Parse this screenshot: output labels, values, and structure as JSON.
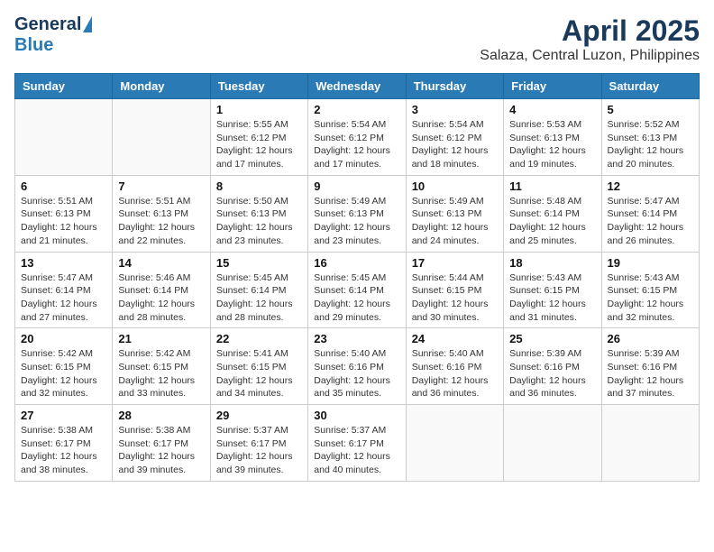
{
  "logo": {
    "general": "General",
    "blue": "Blue"
  },
  "title": "April 2025",
  "subtitle": "Salaza, Central Luzon, Philippines",
  "headers": [
    "Sunday",
    "Monday",
    "Tuesday",
    "Wednesday",
    "Thursday",
    "Friday",
    "Saturday"
  ],
  "weeks": [
    [
      {
        "day": "",
        "info": ""
      },
      {
        "day": "",
        "info": ""
      },
      {
        "day": "1",
        "info": "Sunrise: 5:55 AM\nSunset: 6:12 PM\nDaylight: 12 hours and 17 minutes."
      },
      {
        "day": "2",
        "info": "Sunrise: 5:54 AM\nSunset: 6:12 PM\nDaylight: 12 hours and 17 minutes."
      },
      {
        "day": "3",
        "info": "Sunrise: 5:54 AM\nSunset: 6:12 PM\nDaylight: 12 hours and 18 minutes."
      },
      {
        "day": "4",
        "info": "Sunrise: 5:53 AM\nSunset: 6:13 PM\nDaylight: 12 hours and 19 minutes."
      },
      {
        "day": "5",
        "info": "Sunrise: 5:52 AM\nSunset: 6:13 PM\nDaylight: 12 hours and 20 minutes."
      }
    ],
    [
      {
        "day": "6",
        "info": "Sunrise: 5:51 AM\nSunset: 6:13 PM\nDaylight: 12 hours and 21 minutes."
      },
      {
        "day": "7",
        "info": "Sunrise: 5:51 AM\nSunset: 6:13 PM\nDaylight: 12 hours and 22 minutes."
      },
      {
        "day": "8",
        "info": "Sunrise: 5:50 AM\nSunset: 6:13 PM\nDaylight: 12 hours and 23 minutes."
      },
      {
        "day": "9",
        "info": "Sunrise: 5:49 AM\nSunset: 6:13 PM\nDaylight: 12 hours and 23 minutes."
      },
      {
        "day": "10",
        "info": "Sunrise: 5:49 AM\nSunset: 6:13 PM\nDaylight: 12 hours and 24 minutes."
      },
      {
        "day": "11",
        "info": "Sunrise: 5:48 AM\nSunset: 6:14 PM\nDaylight: 12 hours and 25 minutes."
      },
      {
        "day": "12",
        "info": "Sunrise: 5:47 AM\nSunset: 6:14 PM\nDaylight: 12 hours and 26 minutes."
      }
    ],
    [
      {
        "day": "13",
        "info": "Sunrise: 5:47 AM\nSunset: 6:14 PM\nDaylight: 12 hours and 27 minutes."
      },
      {
        "day": "14",
        "info": "Sunrise: 5:46 AM\nSunset: 6:14 PM\nDaylight: 12 hours and 28 minutes."
      },
      {
        "day": "15",
        "info": "Sunrise: 5:45 AM\nSunset: 6:14 PM\nDaylight: 12 hours and 28 minutes."
      },
      {
        "day": "16",
        "info": "Sunrise: 5:45 AM\nSunset: 6:14 PM\nDaylight: 12 hours and 29 minutes."
      },
      {
        "day": "17",
        "info": "Sunrise: 5:44 AM\nSunset: 6:15 PM\nDaylight: 12 hours and 30 minutes."
      },
      {
        "day": "18",
        "info": "Sunrise: 5:43 AM\nSunset: 6:15 PM\nDaylight: 12 hours and 31 minutes."
      },
      {
        "day": "19",
        "info": "Sunrise: 5:43 AM\nSunset: 6:15 PM\nDaylight: 12 hours and 32 minutes."
      }
    ],
    [
      {
        "day": "20",
        "info": "Sunrise: 5:42 AM\nSunset: 6:15 PM\nDaylight: 12 hours and 32 minutes."
      },
      {
        "day": "21",
        "info": "Sunrise: 5:42 AM\nSunset: 6:15 PM\nDaylight: 12 hours and 33 minutes."
      },
      {
        "day": "22",
        "info": "Sunrise: 5:41 AM\nSunset: 6:15 PM\nDaylight: 12 hours and 34 minutes."
      },
      {
        "day": "23",
        "info": "Sunrise: 5:40 AM\nSunset: 6:16 PM\nDaylight: 12 hours and 35 minutes."
      },
      {
        "day": "24",
        "info": "Sunrise: 5:40 AM\nSunset: 6:16 PM\nDaylight: 12 hours and 36 minutes."
      },
      {
        "day": "25",
        "info": "Sunrise: 5:39 AM\nSunset: 6:16 PM\nDaylight: 12 hours and 36 minutes."
      },
      {
        "day": "26",
        "info": "Sunrise: 5:39 AM\nSunset: 6:16 PM\nDaylight: 12 hours and 37 minutes."
      }
    ],
    [
      {
        "day": "27",
        "info": "Sunrise: 5:38 AM\nSunset: 6:17 PM\nDaylight: 12 hours and 38 minutes."
      },
      {
        "day": "28",
        "info": "Sunrise: 5:38 AM\nSunset: 6:17 PM\nDaylight: 12 hours and 39 minutes."
      },
      {
        "day": "29",
        "info": "Sunrise: 5:37 AM\nSunset: 6:17 PM\nDaylight: 12 hours and 39 minutes."
      },
      {
        "day": "30",
        "info": "Sunrise: 5:37 AM\nSunset: 6:17 PM\nDaylight: 12 hours and 40 minutes."
      },
      {
        "day": "",
        "info": ""
      },
      {
        "day": "",
        "info": ""
      },
      {
        "day": "",
        "info": ""
      }
    ]
  ]
}
